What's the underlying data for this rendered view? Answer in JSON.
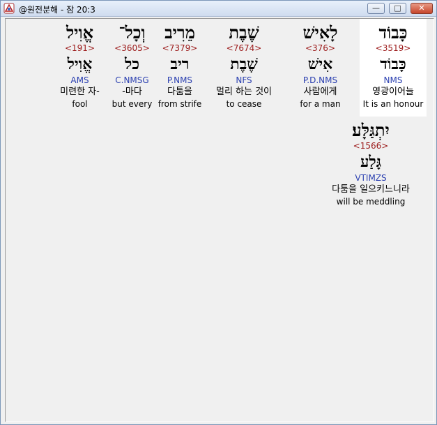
{
  "window": {
    "title": "@원전분해 - 잠 20:3",
    "buttons": {
      "minimize": "—",
      "maximize": "□",
      "close": "✕"
    },
    "icon": "app-icon"
  },
  "words": [
    {
      "hebrew": "אֱוִיל",
      "strong": "<191>",
      "lemma": "אֱוִיל",
      "morph": "AMS",
      "korean": "미련한 자-",
      "english": "fool"
    },
    {
      "hebrew": "וְכָל־",
      "strong": "<3605>",
      "lemma": "כל",
      "morph": "C.NMSG",
      "korean": "-마다",
      "english": "but every"
    },
    {
      "hebrew": "מֵרִיב",
      "strong": "<7379>",
      "lemma": "ריב",
      "morph": "P.NMS",
      "korean": "다툼을",
      "english": "from strife"
    },
    {
      "hebrew": "שֶׁבֶת",
      "strong": "<7674>",
      "lemma": "שֶׁבֶת",
      "morph": "NFS",
      "korean": "멀리 하는 것이",
      "english": "to cease"
    },
    {
      "hebrew": "לָאִישׁ",
      "strong": "<376>",
      "lemma": "אִישׁ",
      "morph": "P.D.NMS",
      "korean": "사람에게",
      "english": "for a man"
    },
    {
      "hebrew": "כָּבוֹד",
      "strong": "<3519>",
      "lemma": "כָּבוֹד",
      "morph": "NMS",
      "korean": "영광이어늘",
      "english": "It is an honour"
    },
    {
      "hebrew": "יִתְגַּלָּע׃",
      "strong": "<1566>",
      "lemma": "גָּלַע",
      "morph": "VTIMZS",
      "korean": "다툼을 일으키느니라",
      "english": "will be meddling"
    }
  ]
}
